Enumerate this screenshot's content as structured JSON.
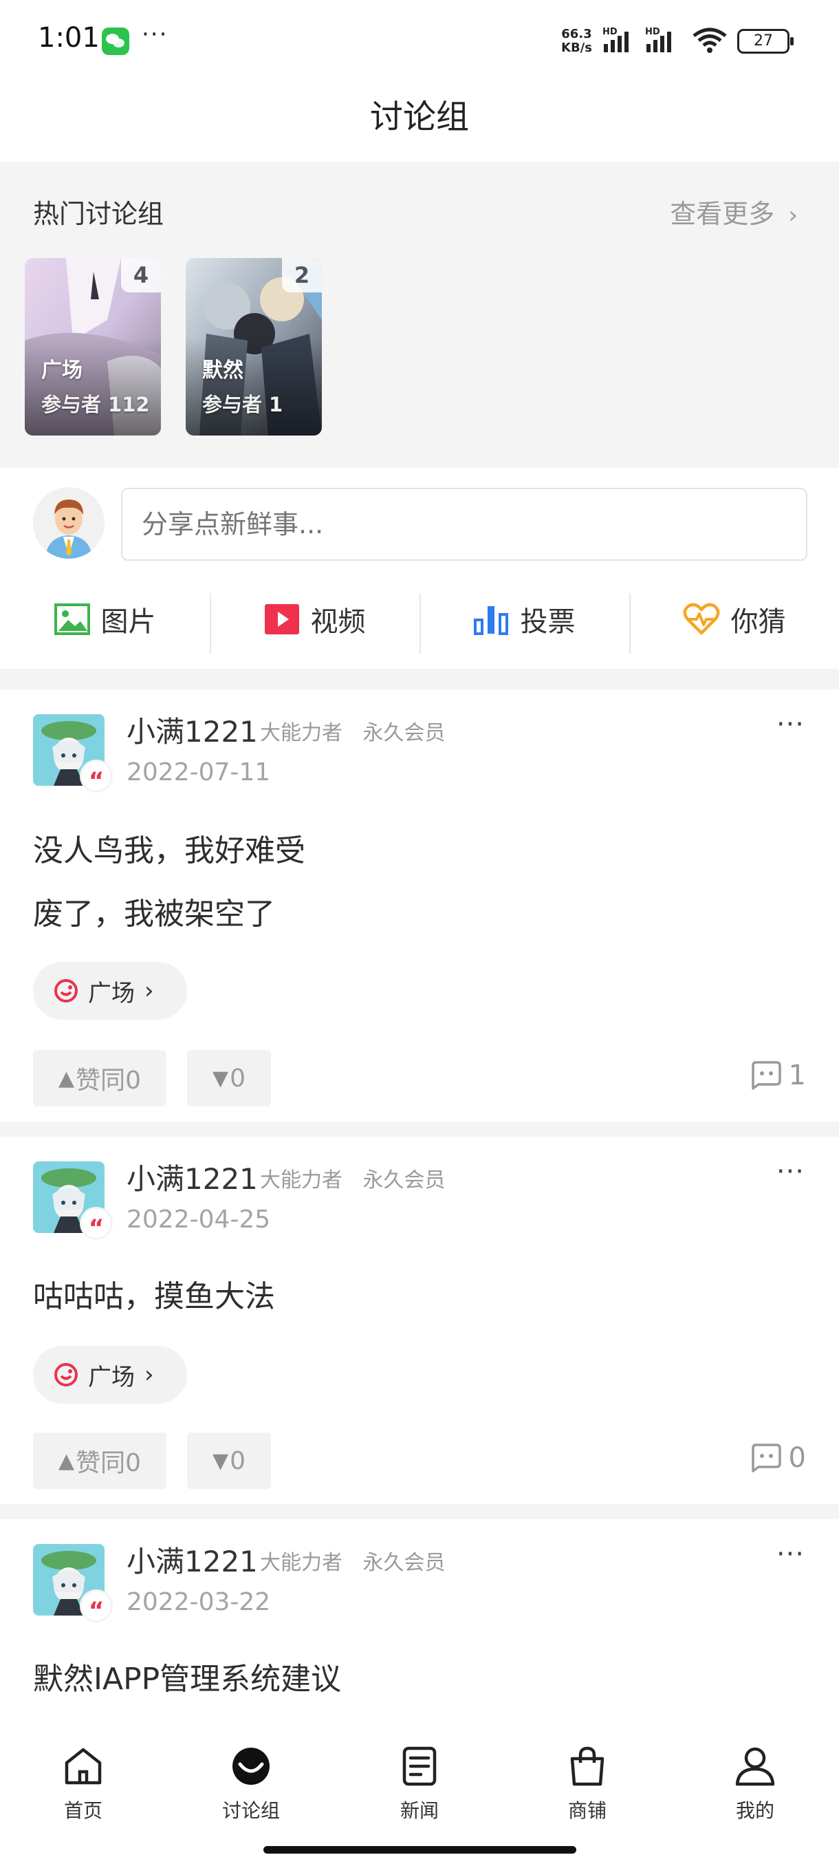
{
  "status_bar": {
    "time": "1:01",
    "speed_value": "66.3",
    "speed_unit": "KB/s",
    "net_badge": "HD",
    "battery": "27",
    "menu_dots": "···"
  },
  "page_title": "讨论组",
  "hot": {
    "title": "热门讨论组",
    "more_label": "查看更多",
    "groups": [
      {
        "name": "广场",
        "participants_label": "参与者",
        "participants": "112",
        "count": "4"
      },
      {
        "name": "默然",
        "participants_label": "参与者",
        "participants": "1",
        "count": "2"
      }
    ]
  },
  "composer": {
    "placeholder": "分享点新鲜事..."
  },
  "actions": [
    {
      "label": "图片",
      "icon": "image-icon",
      "color": "#3bb44a"
    },
    {
      "label": "视频",
      "icon": "video-icon",
      "color": "#f0314d"
    },
    {
      "label": "投票",
      "icon": "vote-chart-icon",
      "color": "#2f7bf0"
    },
    {
      "label": "你猜",
      "icon": "heart-pulse-icon",
      "color": "#f5a623"
    }
  ],
  "posts": [
    {
      "author": "小满1221",
      "tags": [
        "大能力者",
        "永久会员"
      ],
      "date": "2022-07-11",
      "lines": [
        "没人鸟我，我好难受",
        "废了，我被架空了"
      ],
      "group": "广场",
      "upvote_label": "赞同0",
      "downvote_label": "0",
      "comments": "1"
    },
    {
      "author": "小满1221",
      "tags": [
        "大能力者",
        "永久会员"
      ],
      "date": "2022-04-25",
      "lines": [
        "咕咕咕，摸鱼大法"
      ],
      "group": "广场",
      "upvote_label": "赞同0",
      "downvote_label": "0",
      "comments": "0"
    },
    {
      "author": "小满1221",
      "tags": [
        "大能力者",
        "永久会员"
      ],
      "date": "2022-03-22",
      "lines": [
        "默然IAPP管理系统建议"
      ]
    }
  ],
  "nav": [
    {
      "label": "首页",
      "icon": "home-icon"
    },
    {
      "label": "讨论组",
      "icon": "discussion-icon",
      "active": true
    },
    {
      "label": "新闻",
      "icon": "news-icon"
    },
    {
      "label": "商铺",
      "icon": "shop-bag-icon"
    },
    {
      "label": "我的",
      "icon": "profile-icon"
    }
  ],
  "colors": {
    "accent_red": "#e8344e",
    "chip_icon": "#e8344e",
    "panel_bg": "#f4f4f4"
  }
}
